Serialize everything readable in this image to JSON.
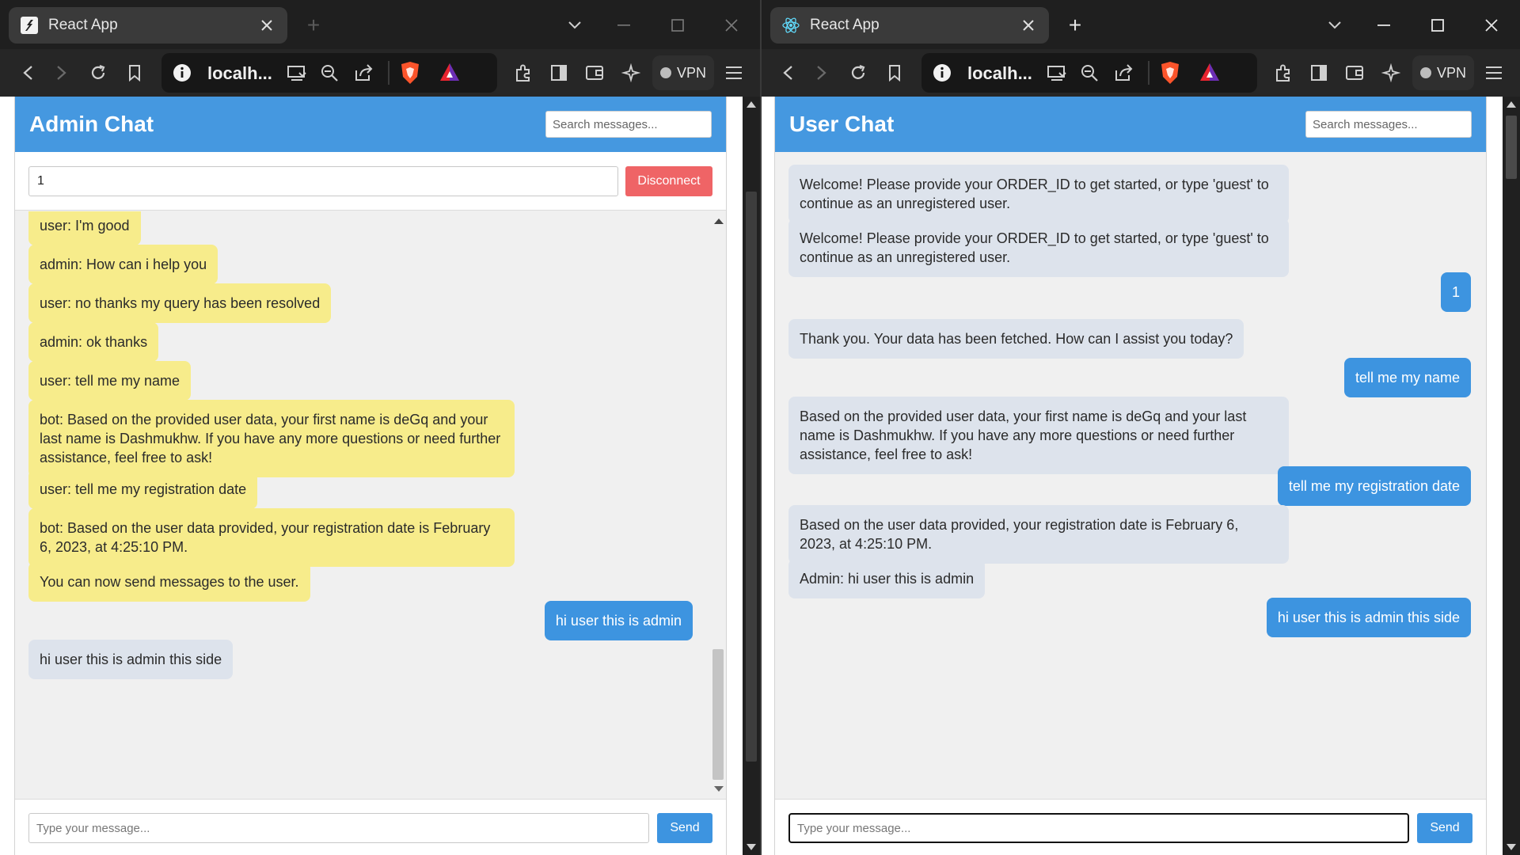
{
  "left_window": {
    "tab_title": "React App",
    "url": "localh...",
    "vpn_label": "VPN",
    "app": {
      "title": "Admin Chat",
      "search_placeholder": "Search messages...",
      "order_input_value": "1",
      "disconnect_label": "Disconnect",
      "messages": [
        {
          "text": "user: I'm good",
          "sender": "user"
        },
        {
          "text": "admin: How can i help you",
          "sender": "admin"
        },
        {
          "text": "user: no thanks my query has been resolved",
          "sender": "user"
        },
        {
          "text": "admin: ok thanks",
          "sender": "admin"
        },
        {
          "text": "user: tell me my name",
          "sender": "user"
        },
        {
          "text": "bot: Based on the provided user data, your first name is deGq and your last name is Dashmukhw. If you have any more questions or need further assistance, feel free to ask!",
          "sender": "bot"
        },
        {
          "text": "user: tell me my registration date",
          "sender": "user"
        },
        {
          "text": "bot: Based on the user data provided, your registration date is February 6, 2023, at 4:25:10 PM.",
          "sender": "bot"
        },
        {
          "text": "You can now send messages to the user.",
          "sender": "system"
        },
        {
          "text": "hi user this is admin",
          "sender": "self"
        },
        {
          "text": "hi user this is admin this side",
          "sender": "remote"
        }
      ],
      "message_placeholder": "Type your message...",
      "send_label": "Send"
    }
  },
  "right_window": {
    "tab_title": "React App",
    "url": "localh...",
    "vpn_label": "VPN",
    "app": {
      "title": "User Chat",
      "search_placeholder": "Search messages...",
      "messages": [
        {
          "text": "Welcome! Please provide your ORDER_ID to get started, or type 'guest' to continue as an unregistered user.",
          "sender": "bot"
        },
        {
          "text": "Welcome! Please provide your ORDER_ID to get started, or type 'guest' to continue as an unregistered user.",
          "sender": "bot"
        },
        {
          "text": "1",
          "sender": "self"
        },
        {
          "text": "Thank you. Your data has been fetched. How can I assist you today?",
          "sender": "bot"
        },
        {
          "text": "tell me my name",
          "sender": "self"
        },
        {
          "text": "Based on the provided user data, your first name is deGq and your last name is Dashmukhw. If you have any more questions or need further assistance, feel free to ask!",
          "sender": "bot"
        },
        {
          "text": "tell me my registration date",
          "sender": "self"
        },
        {
          "text": "Based on the user data provided, your registration date is February 6, 2023, at 4:25:10 PM.",
          "sender": "bot"
        },
        {
          "text": "Admin: hi user this is admin",
          "sender": "admin"
        },
        {
          "text": "hi user this is admin this side",
          "sender": "self"
        }
      ],
      "message_placeholder": "Type your message...",
      "send_label": "Send"
    }
  },
  "colors": {
    "header_blue": "#4598e0",
    "bubble_yellow": "#f7ec8b",
    "bubble_grey": "#dde3ec",
    "bubble_blue": "#3d94e0",
    "disconnect_red": "#ef6466"
  },
  "icons": [
    "back-icon",
    "forward-icon",
    "reload-icon",
    "bookmark-icon",
    "info-icon",
    "cast-icon",
    "zoom-out-icon",
    "share-icon",
    "brave-shield-icon",
    "brave-rewards-icon",
    "extensions-icon",
    "sidebar-icon",
    "wallet-icon",
    "leo-ai-icon",
    "menu-icon",
    "react-favicon",
    "close-tab-icon",
    "new-tab-icon",
    "tab-search-icon",
    "minimize-icon",
    "maximize-icon",
    "close-window-icon"
  ]
}
